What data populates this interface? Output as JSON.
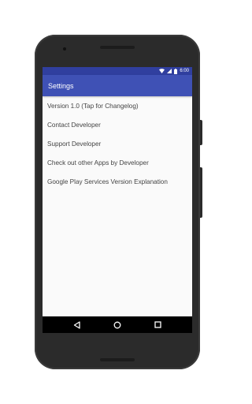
{
  "status_bar": {
    "time": "6:00",
    "icons": [
      "wifi-icon",
      "cell-signal-icon",
      "battery-icon"
    ]
  },
  "app_bar": {
    "title": "Settings"
  },
  "settings": {
    "items": [
      {
        "label": "Version 1.0 (Tap for Changelog)"
      },
      {
        "label": "Contact Developer"
      },
      {
        "label": "Support Developer"
      },
      {
        "label": "Check out other Apps by Developer"
      },
      {
        "label": "Google Play Services Version Explanation"
      }
    ]
  },
  "nav_bar": {
    "icons": [
      "back-icon",
      "home-icon",
      "recents-icon"
    ]
  },
  "colors": {
    "primary": "#3f51b5",
    "primary_dark": "#303f9f",
    "background": "#fafafa",
    "text": "#444444"
  }
}
